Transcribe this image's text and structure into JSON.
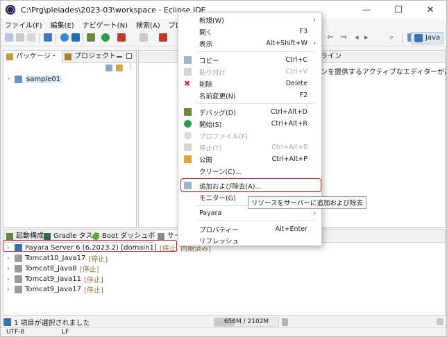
{
  "window": {
    "title": "C:\\Prg\\pleiades\\2023-03\\workspace - Eclipse IDE",
    "controls": [
      "—",
      "☐",
      "✕"
    ]
  },
  "menubar": [
    "ファイル(F)",
    "編集(E)",
    "ナビゲート(N)",
    "検索(A)",
    "プロジェクト(P)"
  ],
  "toolbar": {
    "perspective_label": "Java",
    "search_icon": "search-icon"
  },
  "package_explorer": {
    "tab_label": "パッケージ・",
    "tab2_label": "プロジェクト",
    "project": "sample01"
  },
  "editor": {
    "tab_label": "ライン",
    "message": "ンを提供するアクティブなエディターがありません。"
  },
  "servers_pane": {
    "tabs": [
      "起動構成",
      "Gradle タスク",
      "Boot ダッシュボード",
      "サーバ"
    ],
    "servers": [
      {
        "name": "Payara Server 6 (6.2023.2) [domain1]",
        "status": "[停止, 同期済み]"
      },
      {
        "name": "Tomcat10_Java17",
        "status": "[停止]"
      },
      {
        "name": "Tomcat8_Java8",
        "status": "[停止]"
      },
      {
        "name": "Tomcat9_Java11",
        "status": "[停止]"
      },
      {
        "name": "Tomcat9_Java17",
        "status": "[停止]"
      }
    ]
  },
  "statusbar": {
    "selection": "1 項目が選択されました",
    "heap": "656M / 2102M",
    "heap_used_fraction": 0.31,
    "encoding": "UTF-8",
    "line_delimiter": "LF"
  },
  "context_menu": {
    "items": [
      {
        "label": "新規(W)",
        "shortcut": "",
        "submenu": true,
        "disabled": false
      },
      {
        "label": "開く",
        "shortcut": "F3",
        "submenu": false,
        "disabled": false
      },
      {
        "label": "表示",
        "shortcut": "Alt+Shift+W",
        "submenu": true,
        "disabled": false
      },
      {
        "label": "コピー",
        "shortcut": "Ctrl+C",
        "submenu": false,
        "disabled": false
      },
      {
        "label": "貼り付け",
        "shortcut": "Ctrl+V",
        "submenu": false,
        "disabled": true
      },
      {
        "label": "削除",
        "shortcut": "Delete",
        "submenu": false,
        "disabled": false
      },
      {
        "label": "名前変更(N)",
        "shortcut": "F2",
        "submenu": false,
        "disabled": false
      },
      {
        "label": "デバッグ(D)",
        "shortcut": "Ctrl+Alt+D",
        "submenu": false,
        "disabled": false
      },
      {
        "label": "開始(S)",
        "shortcut": "Ctrl+Alt+R",
        "submenu": false,
        "disabled": false
      },
      {
        "label": "プロファイル(F)",
        "shortcut": "",
        "submenu": false,
        "disabled": true
      },
      {
        "label": "停止(T)",
        "shortcut": "Ctrl+Alt+S",
        "submenu": false,
        "disabled": true
      },
      {
        "label": "公開",
        "shortcut": "Ctrl+Alt+P",
        "submenu": false,
        "disabled": false
      },
      {
        "label": "クリーン(C)...",
        "shortcut": "",
        "submenu": false,
        "disabled": false
      },
      {
        "label": "追加および除去(A)...",
        "shortcut": "",
        "submenu": false,
        "disabled": false
      },
      {
        "label": "モニター(G)",
        "shortcut": "",
        "submenu": true,
        "disabled": false
      },
      {
        "label": "Payara",
        "shortcut": "",
        "submenu": true,
        "disabled": false
      },
      {
        "label": "プロパティー",
        "shortcut": "Alt+Enter",
        "submenu": false,
        "disabled": false
      },
      {
        "label": "リフレッシュ",
        "shortcut": "",
        "submenu": false,
        "disabled": false
      }
    ]
  },
  "tooltip": "リソースをサーバーに追加および除去",
  "colors": {
    "highlight_border": "#cc1f1f",
    "selection_bg": "#d7e6f7"
  }
}
